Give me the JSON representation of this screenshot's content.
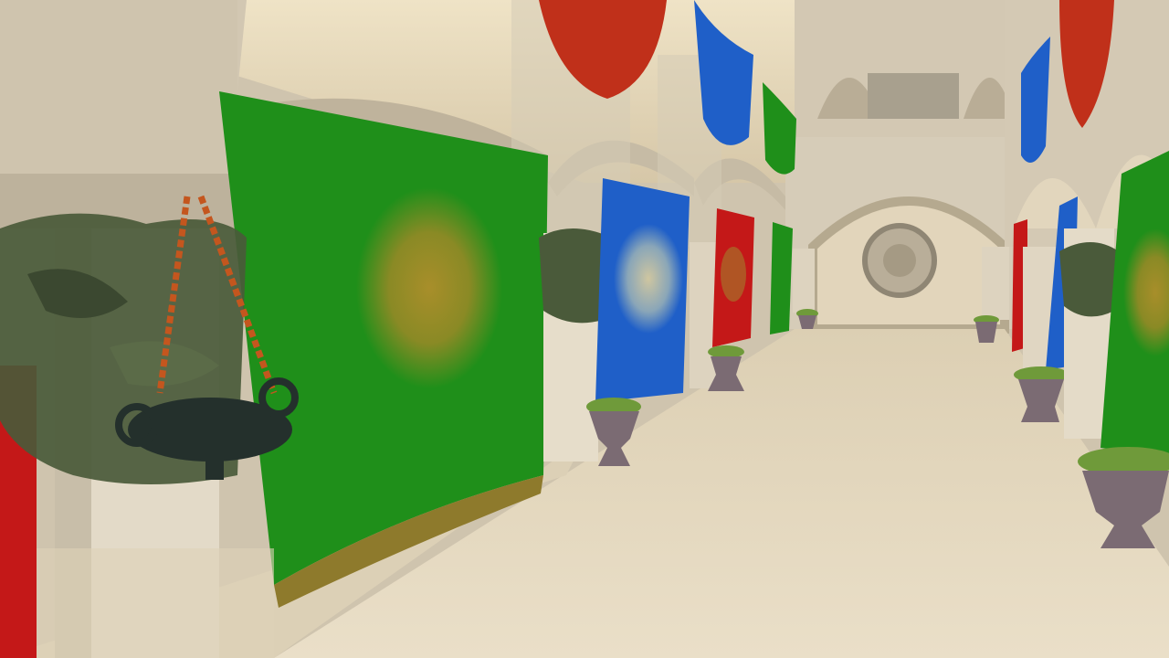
{
  "scene": {
    "name": "pixelated-atrium-corridor",
    "palette": {
      "stone": "#d9cfbd",
      "stone_shadow": "#a99f8c",
      "floor": "#e4d7bd",
      "ceiling": "#e9dcc0",
      "banner_green": "#1f8f1a",
      "banner_blue": "#1f5fc8",
      "banner_red": "#c41818",
      "emblem_gold": "#9c8a2a",
      "ivy": "#4a5a3a",
      "chain": "#c4561e",
      "bowl": "#24302c",
      "urn": "#7b6b73",
      "plant": "#6f9a3a"
    }
  }
}
